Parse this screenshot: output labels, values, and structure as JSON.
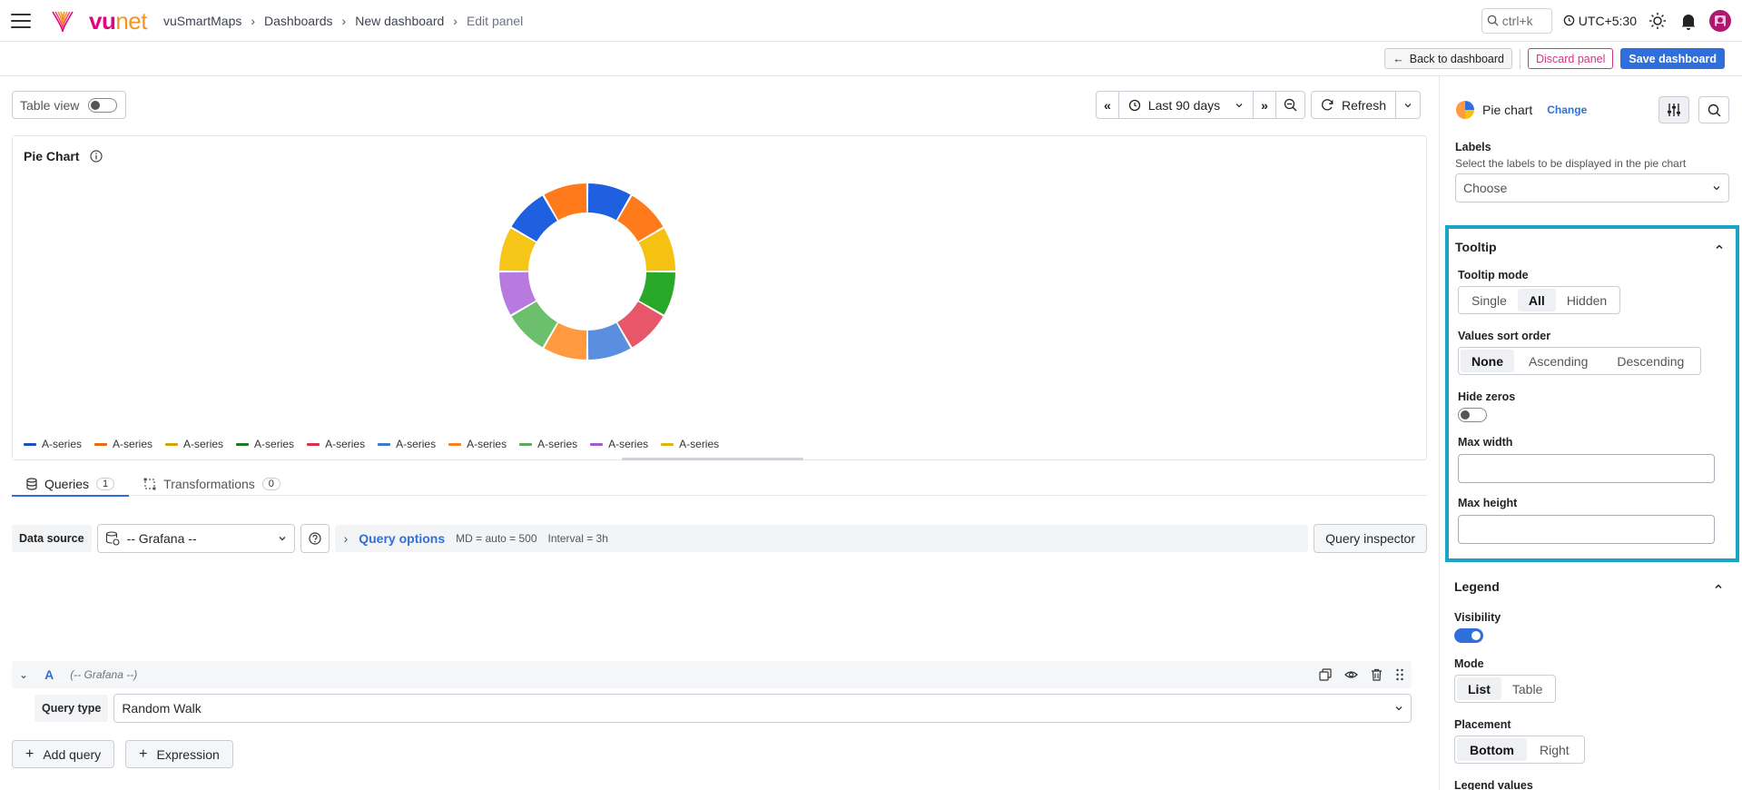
{
  "header": {
    "brand": {
      "part1": "vu",
      "part2": "net"
    },
    "breadcrumb": [
      "vuSmartMaps",
      "Dashboards",
      "New dashboard",
      "Edit panel"
    ],
    "search_hint": "ctrl+k",
    "timezone": "UTC+5:30"
  },
  "actions": {
    "back": "Back to dashboard",
    "discard": "Discard panel",
    "save": "Save dashboard"
  },
  "toolbar": {
    "table_view": "Table view",
    "time_range": "Last 90 days",
    "refresh": "Refresh"
  },
  "panel": {
    "title": "Pie Chart"
  },
  "chart_data": {
    "type": "pie",
    "subtype": "donut",
    "categories": [
      "A-series",
      "A-series",
      "A-series",
      "A-series",
      "A-series",
      "A-series",
      "A-series",
      "A-series",
      "A-series",
      "A-series",
      "A-series",
      "A-series"
    ],
    "values": [
      1,
      1,
      1,
      1,
      1,
      1,
      1,
      1,
      1,
      1,
      1,
      1
    ],
    "slice_colors": [
      "#1f60e0",
      "#ff7a1a",
      "#f5c211",
      "#2aa82a",
      "#e8566a",
      "#5a8fe0",
      "#ff9a40",
      "#6cbf6c",
      "#b77be0",
      "#f5c518",
      "#1f60e0",
      "#ff7a1a"
    ],
    "legend": {
      "placement": "bottom",
      "labels": [
        "A-series",
        "A-series",
        "A-series",
        "A-series",
        "A-series",
        "A-series",
        "A-series",
        "A-series",
        "A-series",
        "A-series"
      ],
      "colors": [
        "#1f4fb8",
        "#e86a17",
        "#d4a20d",
        "#1f7a1f",
        "#d6304e",
        "#3f78d0",
        "#f5821f",
        "#5ea85e",
        "#a05ad0",
        "#e0b410"
      ]
    }
  },
  "queries": {
    "tabs": [
      {
        "label": "Queries",
        "count": "1"
      },
      {
        "label": "Transformations",
        "count": "0"
      }
    ],
    "data_source_label": "Data source",
    "data_source_value": "-- Grafana --",
    "query_options_title": "Query options",
    "md": "MD = auto = 500",
    "interval": "Interval = 3h",
    "inspector": "Query inspector",
    "query_letter": "A",
    "query_source": "(-- Grafana --)",
    "query_type_label": "Query type",
    "query_type_value": "Random Walk",
    "add_query": "Add query",
    "expression": "Expression"
  },
  "options": {
    "vis_name": "Pie chart",
    "change": "Change",
    "labels": {
      "title": "Labels",
      "desc": "Select the labels to be displayed in the pie chart",
      "placeholder": "Choose"
    },
    "tooltip": {
      "title": "Tooltip",
      "mode_label": "Tooltip mode",
      "modes": [
        "Single",
        "All",
        "Hidden"
      ],
      "mode_selected": "All",
      "sort_label": "Values sort order",
      "sorts": [
        "None",
        "Ascending",
        "Descending"
      ],
      "sort_selected": "None",
      "hide_zeros_label": "Hide zeros",
      "hide_zeros": false,
      "max_width_label": "Max width",
      "max_width_value": "",
      "max_height_label": "Max height",
      "max_height_value": ""
    },
    "legend": {
      "title": "Legend",
      "visibility_label": "Visibility",
      "visibility": true,
      "mode_label": "Mode",
      "modes": [
        "List",
        "Table"
      ],
      "mode_selected": "List",
      "placement_label": "Placement",
      "placements": [
        "Bottom",
        "Right"
      ],
      "placement_selected": "Bottom",
      "values_label": "Legend values"
    }
  }
}
